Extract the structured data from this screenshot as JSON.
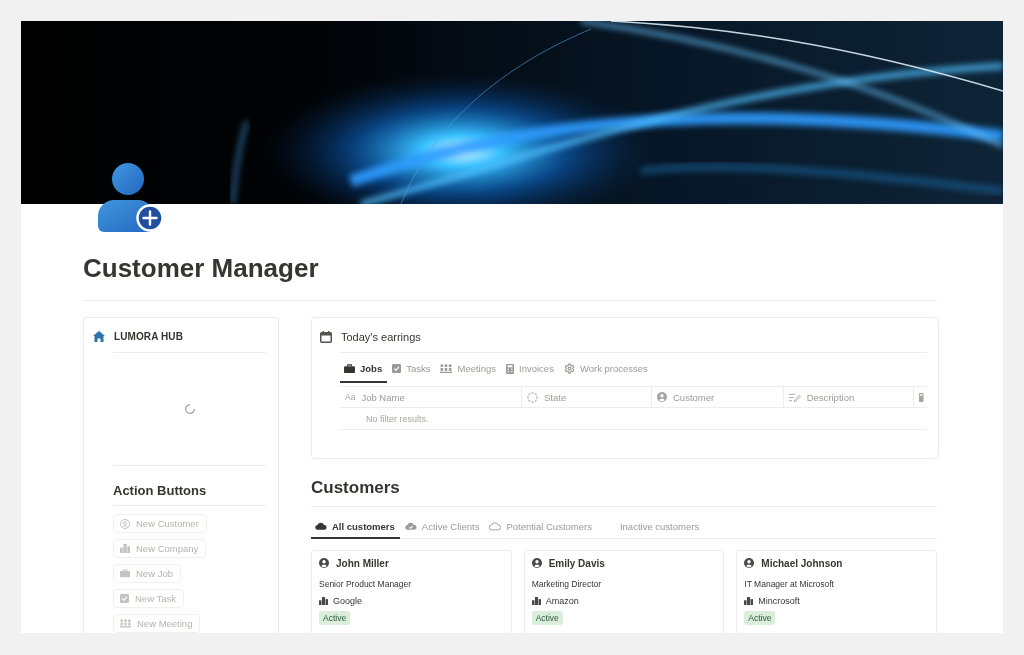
{
  "page": {
    "title": "Customer Manager"
  },
  "sidebar": {
    "title": "LUMORA HUB",
    "loading": true,
    "heading": "Action Buttons",
    "buttons": [
      {
        "label": "New Customer"
      },
      {
        "label": "New Company"
      },
      {
        "label": "New Job"
      },
      {
        "label": "New Task"
      },
      {
        "label": "New Meeting"
      }
    ]
  },
  "earnings": {
    "title": "Today's earrings",
    "tabs": [
      {
        "label": "Jobs",
        "selected": true
      },
      {
        "label": "Tasks",
        "selected": false
      },
      {
        "label": "Meetings",
        "selected": false
      },
      {
        "label": "Invoices",
        "selected": false
      },
      {
        "label": "Work processes",
        "selected": false
      }
    ],
    "columns": [
      {
        "type_mark": "Aa",
        "label": "Job Name"
      },
      {
        "label": "State"
      },
      {
        "label": "Customer"
      },
      {
        "label": "Description"
      }
    ],
    "empty_message": "No filter results."
  },
  "customers": {
    "heading": "Customers",
    "tabs": [
      {
        "label": "All customers",
        "selected": true
      },
      {
        "label": "Active Clients",
        "selected": false
      },
      {
        "label": "Potential Customers",
        "selected": false
      },
      {
        "label": "Inactive customers",
        "selected": false
      }
    ],
    "cards": [
      {
        "name": "John Miller",
        "title": "Senior Product Manager",
        "company": "Google",
        "status": "Active"
      },
      {
        "name": "Emily Davis",
        "title": "Marketing Director",
        "company": "Amazon",
        "status": "Active"
      },
      {
        "name": "Michael Johnson",
        "title": "IT Manager at Microsoft",
        "company": "Mincrosoft",
        "status": "Active"
      }
    ]
  }
}
